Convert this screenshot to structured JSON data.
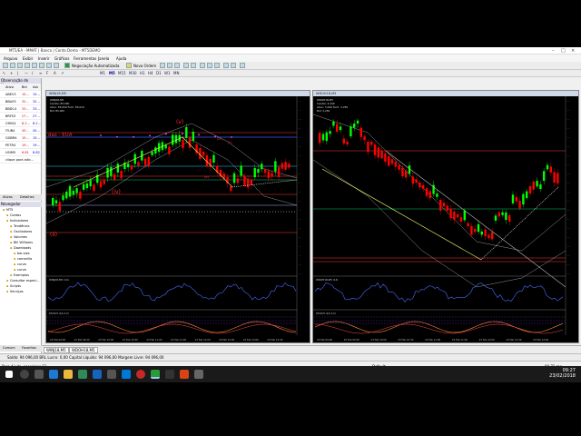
{
  "window": {
    "title": "MT5/EA - MMAT | Banco | Conta Demo - MT5DEMO"
  },
  "menu": [
    "Arquivo",
    "Exibir",
    "Inserir",
    "Gráficos",
    "Ferramentas",
    "Janela",
    "Ajuda"
  ],
  "toolbar": {
    "autotrade_label": "Negociação Automatizada",
    "neworder_label": "Nova Ordem"
  },
  "timeframes": [
    "M1",
    "M5",
    "M15",
    "M30",
    "H1",
    "H4",
    "D1",
    "W1",
    "MN"
  ],
  "market_watch": {
    "title": "Observação do Mercado",
    "columns": [
      "Ativo",
      "Bid",
      "Ask"
    ],
    "rows": [
      {
        "symbol": "ABEV3",
        "bid": "15...",
        "ask": "15..."
      },
      {
        "symbol": "BBAS3",
        "bid": "32...",
        "ask": "32..."
      },
      {
        "symbol": "BBDC4",
        "bid": "33...",
        "ask": "33..."
      },
      {
        "symbol": "BRFS3",
        "bid": "27...",
        "ask": "27..."
      },
      {
        "symbol": "CMIG4",
        "bid": "8.2...",
        "ask": "8.2..."
      },
      {
        "symbol": "ITUB4",
        "bid": "45...",
        "ask": "45..."
      },
      {
        "symbol": "GGBR4",
        "bid": "15...",
        "ask": "15..."
      },
      {
        "symbol": "PETR4",
        "bid": "19...",
        "ask": "19..."
      },
      {
        "symbol": "USIM5",
        "bid": "6.81",
        "ask": "6.82"
      }
    ],
    "add_label": "clique para adic...",
    "tabs": [
      "Ativos",
      "Detalhes"
    ]
  },
  "navigator": {
    "title": "Navegador",
    "items": [
      "MT5",
      "Contas",
      "Indicadores",
      "Tendência",
      "Osciladores",
      "Volumes",
      "Bill Williams",
      "Downloads",
      "bar-size",
      "camarilla",
      "curva",
      "curva",
      "Exemplos",
      "Consultor especi...",
      "Scripts",
      "Serviços"
    ],
    "tabs": [
      "Comum",
      "Favoritos"
    ]
  },
  "chart_left": {
    "title": "WINJ18,M5",
    "info": [
      "WINJ18,M5",
      "Candle: 85,000",
      "Ativo: 85,000  Fech: 85,010",
      "Bid: 85,005"
    ],
    "labels": {
      "v": "(v)",
      "iv": "(iv)",
      "ii": "(ii)",
      "iii": "(iii)",
      "a": "(a)",
      "c": "(c)",
      "das_eua": "das - EUA"
    },
    "sub1": "WINJ18,M5 (14)",
    "sub2": "STOCH (14,3,3)",
    "x_ticks": [
      "23 Feb 09:00",
      "23 Feb 09:30",
      "23 Feb 10:00",
      "23 Feb 10:30",
      "23 Feb 11:00",
      "23 Feb 11:30",
      "23 Feb 12:00",
      "23 Feb 12:30",
      "23 Feb 13:00",
      "23 Feb 13:30"
    ]
  },
  "chart_right": {
    "title": "WDOH18,M5",
    "info": [
      "WDOH18,M5",
      "Candle: 3,249",
      "Ativo: 3,249  Fech: 3,250",
      "Bid: 3,250"
    ],
    "sub1": "WDOH18,M5 (14)",
    "sub2": "STOCH (14,3,3)",
    "x_ticks": [
      "23 Feb 09:00",
      "23 Feb 09:30",
      "23 Feb 10:00",
      "23 Feb 10:30",
      "23 Feb 11:00",
      "23 Feb 11:30",
      "23 Feb 12:00",
      "23 Feb 12:30",
      "23 Feb 13:00"
    ]
  },
  "chart_tabs": [
    "WINJ18,M5",
    "WDOH18,M5"
  ],
  "status": {
    "balance": "Saldo: 94 096,00 BRL  Lucro: 0,00  Capital Líquido: 94 096,00  Margem Livre: 94 096,00",
    "help": "Para Ajuda, pressione F1",
    "profile": "Default",
    "network": "98,71 ms"
  },
  "taskbar": {
    "time": "09:27",
    "date": "23/02/2018"
  },
  "colors": {
    "up": "#00ff00",
    "down": "#ff0000",
    "bg": "#000000",
    "trend": "#ffff66"
  }
}
